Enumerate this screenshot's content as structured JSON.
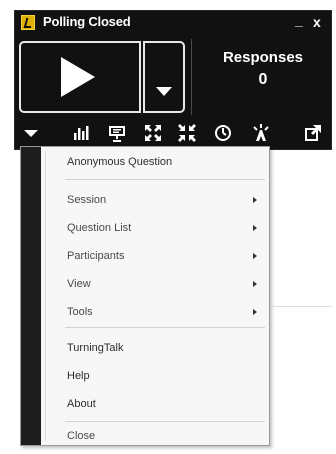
{
  "window": {
    "title": "Polling Closed",
    "minimize_label": "_",
    "close_label": "x"
  },
  "responses": {
    "label": "Responses",
    "count": "0"
  },
  "toolbar": {
    "icons": [
      "menu-toggle-icon",
      "bar-chart-icon",
      "presentation-icon",
      "fullscreen-icon",
      "collapse-icon",
      "timer-icon",
      "pointer-icon",
      "popout-icon"
    ]
  },
  "menu": {
    "anonymous": "Anonymous Question",
    "session": "Session",
    "question_list": "Question List",
    "participants": "Participants",
    "view": "View",
    "tools": "Tools",
    "turningtalk": "TurningTalk",
    "help": "Help",
    "about": "About",
    "close": "Close"
  },
  "colors": {
    "widget_bg": "#111111",
    "accent_icon": "#e0b000",
    "menu_bg": "#f7f7f7"
  }
}
